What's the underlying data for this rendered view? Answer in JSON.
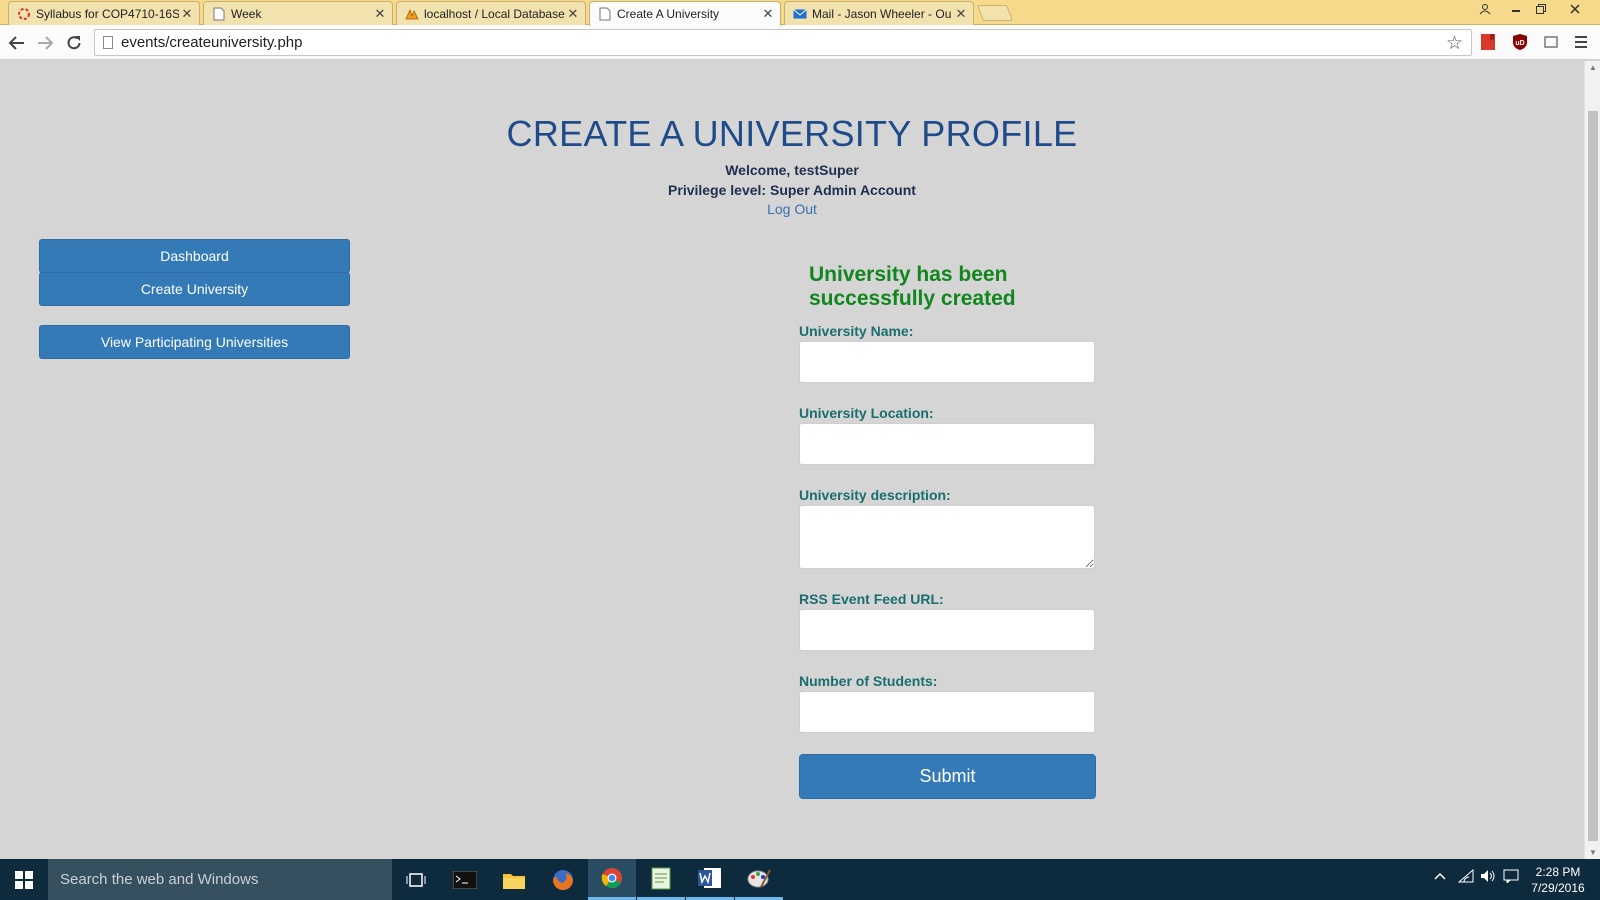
{
  "browser": {
    "tabs": [
      {
        "title": "Syllabus for COP4710-16S",
        "icon": "ring-icon"
      },
      {
        "title": "Week",
        "icon": "page-icon"
      },
      {
        "title": "localhost / Local Database",
        "icon": "phpmyadmin-icon"
      },
      {
        "title": "Create A University",
        "icon": "page-icon"
      },
      {
        "title": "Mail - Jason Wheeler - Ou",
        "icon": "mail-icon"
      }
    ],
    "close_glyph": "✕",
    "address": "events/createuniversity.php",
    "ext_ublock_text": "uD"
  },
  "page": {
    "title": "CREATE A UNIVERSITY PROFILE",
    "welcome": "Welcome, testSuper",
    "privilege": "Privilege level: Super Admin Account",
    "logout": "Log Out",
    "sidebar": {
      "dashboard": "Dashboard",
      "create_university": "Create University",
      "view_universities": "View Participating Universities"
    },
    "success_message": "University has been successfully created",
    "form": {
      "name_label": "University Name:",
      "location_label": "University Location:",
      "description_label": "University description:",
      "rss_label": "RSS Event Feed URL:",
      "students_label": "Number of Students:",
      "submit": "Submit"
    },
    "colors": {
      "title": "#1f4b8a",
      "button": "#337ab7",
      "success": "#12861e",
      "label": "#1a6e6e",
      "background": "#d5d5d5"
    }
  },
  "taskbar": {
    "search_placeholder": "Search the web and Windows",
    "apps": [
      "task-view-icon",
      "terminal-icon",
      "file-explorer-icon",
      "firefox-icon",
      "chrome-icon",
      "notepad-icon",
      "word-icon",
      "paint-icon"
    ],
    "time": "2:28 PM",
    "date": "7/29/2016"
  }
}
